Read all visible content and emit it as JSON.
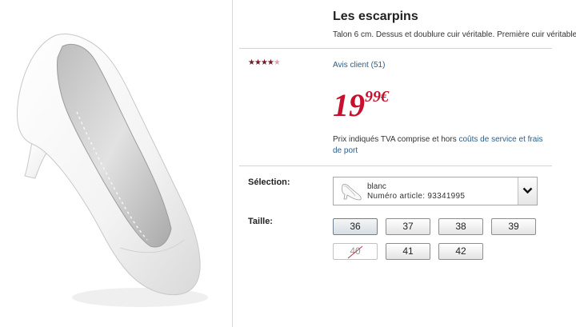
{
  "product": {
    "title": "Les escarpins",
    "description": "Talon 6 cm. Dessus et doublure cuir véritable. Première cuir véritable.",
    "rating": 4,
    "rating_max": 5,
    "reviews_link": "Avis client (51)",
    "price": {
      "integer": "19",
      "decimals": "99€"
    },
    "price_note_text": "Prix indiqués TVA comprise et hors ",
    "price_note_link": "coûts de service et frais de port"
  },
  "selection": {
    "label": "Sélection:",
    "color": "blanc",
    "article": "Numéro article: 93341995"
  },
  "sizes": {
    "label": "Taille:",
    "options": [
      {
        "value": "36",
        "state": "selected"
      },
      {
        "value": "37",
        "state": "available"
      },
      {
        "value": "38",
        "state": "available"
      },
      {
        "value": "39",
        "state": "available"
      },
      {
        "value": "40",
        "state": "unavailable"
      },
      {
        "value": "41",
        "state": "available"
      },
      {
        "value": "42",
        "state": "available"
      }
    ]
  },
  "colors": {
    "price_red": "#c8102e",
    "link_blue": "#2a5e8c",
    "star_on": "#7a1626",
    "star_off": "#d7a4ad"
  },
  "icons": {
    "dropdown": "chevron-down-icon",
    "shoe": "shoe-thumbnail-icon"
  }
}
